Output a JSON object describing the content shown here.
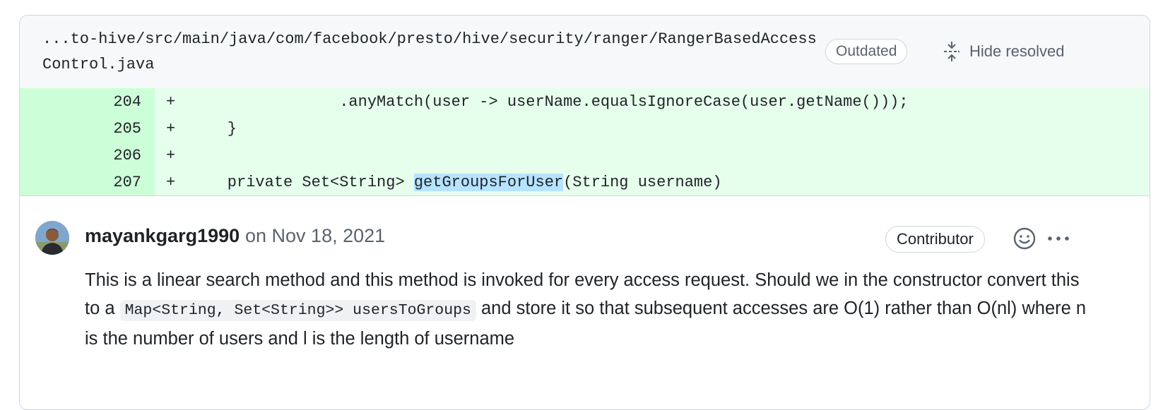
{
  "file_header": {
    "path": "...to-hive/src/main/java/com/facebook/presto/hive/security/ranger/RangerBasedAccessControl.java",
    "outdated_label": "Outdated",
    "hide_resolved_label": "Hide resolved"
  },
  "diff": {
    "lines": [
      {
        "num": "204",
        "sign": "+",
        "code": "                .anyMatch(user -> userName.equalsIgnoreCase(user.getName()));"
      },
      {
        "num": "205",
        "sign": "+",
        "code": "    }"
      },
      {
        "num": "206",
        "sign": "+",
        "code": ""
      },
      {
        "num": "207",
        "sign": "+",
        "code_before": "    private Set<String> ",
        "code_highlight": "getGroupsForUser",
        "code_after": "(String username)"
      }
    ]
  },
  "comment": {
    "author": "mayankgarg1990",
    "meta": "on Nov 18, 2021",
    "role_badge": "Contributor",
    "body_part1": "This is a linear search method and this method is invoked for every access request. Should we in the constructor convert this to a ",
    "body_code": "Map<String, Set<String>> usersToGroups",
    "body_part2": " and store it so that subsequent accesses are O(1) rather than O(nl) where n is the number of users and l is the length of username"
  },
  "icons": {
    "hide_resolved": "fold-icon",
    "emoji": "smiley-icon",
    "more": "kebab-horizontal-icon",
    "avatar": "user-avatar"
  },
  "colors": {
    "diff_added_bg": "#e6ffec",
    "diff_added_num_bg": "#ccffd8",
    "highlight_bg": "#b6e3ff",
    "muted_text": "#59636e",
    "border": "#d0d7de"
  }
}
